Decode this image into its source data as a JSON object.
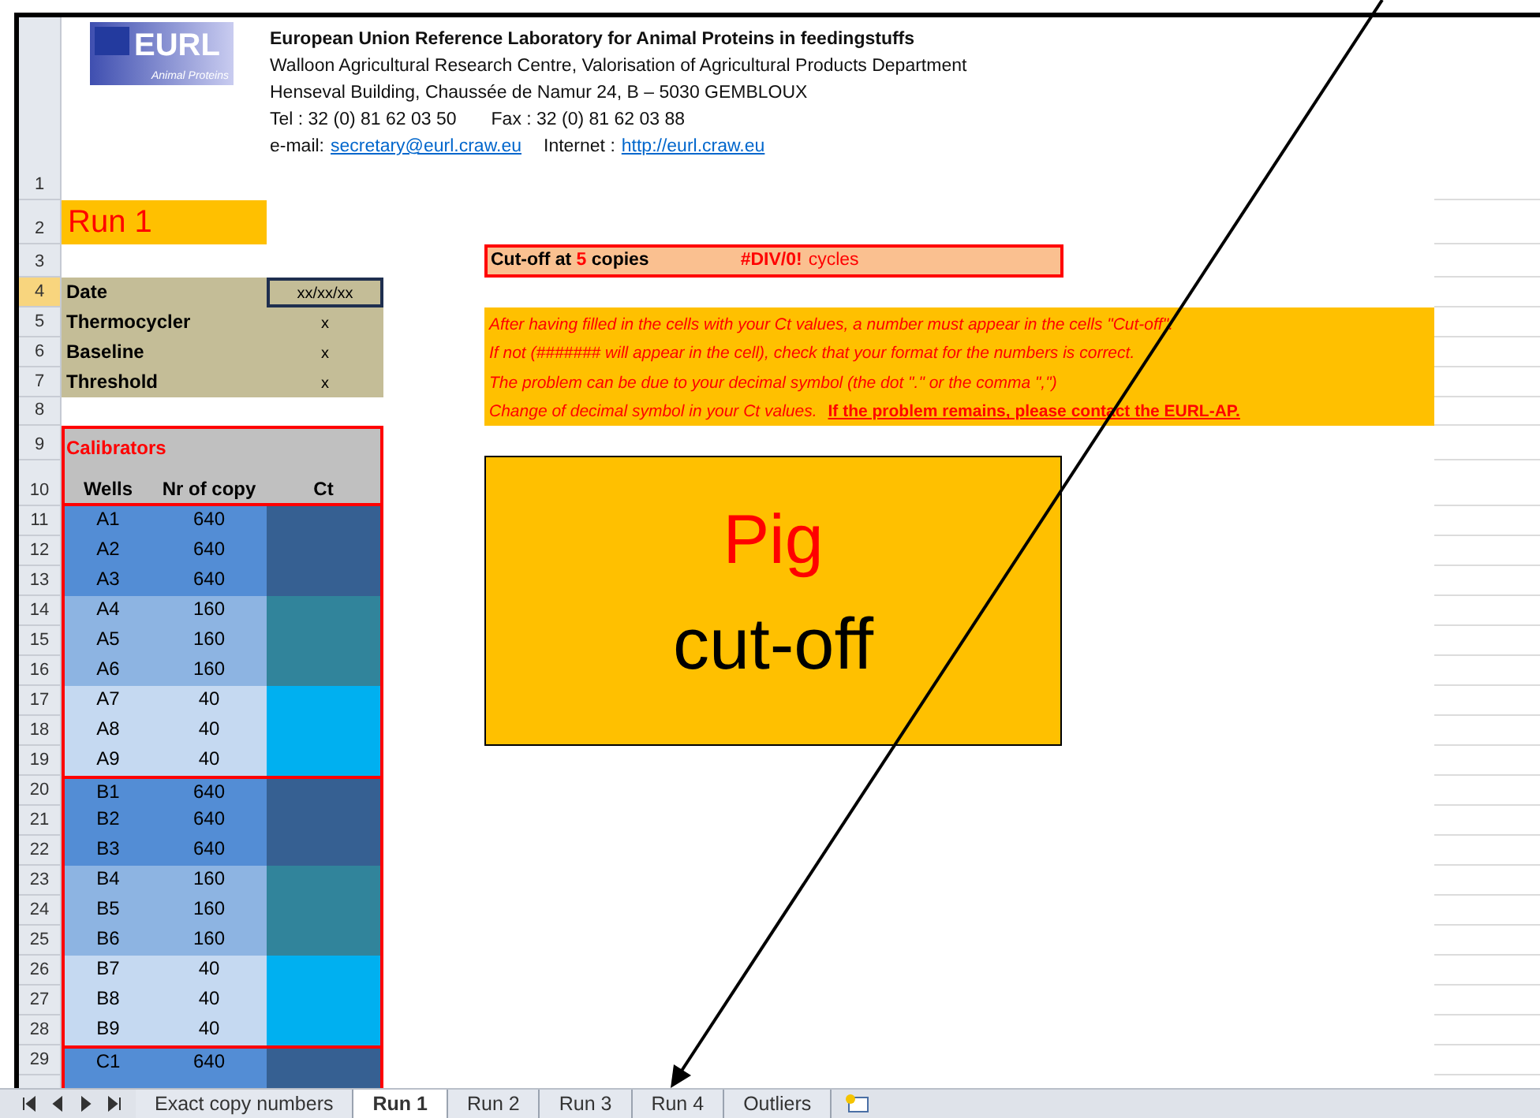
{
  "header": {
    "logo": {
      "text": "EURL",
      "subtitle": "Animal Proteins"
    },
    "title": "European Union Reference Laboratory for Animal Proteins in feedingstuffs",
    "lines": [
      "Walloon Agricultural Research Centre, Valorisation of Agricultural Products Department",
      "Henseval Building, Chaussée de Namur 24,  B – 5030  GEMBLOUX"
    ],
    "phone": "Tel : 32 (0) 81 62 03 50",
    "fax": "Fax : 32 (0) 81 62 03 88",
    "email_label": "e-mail:",
    "email": "secretary@eurl.craw.eu",
    "internet_label": "Internet :",
    "internet": "http://eurl.craw.eu"
  },
  "row_headers": [
    {
      "label": "1",
      "selected": false
    },
    {
      "label": "2",
      "selected": false
    },
    {
      "label": "3",
      "selected": false
    },
    {
      "label": "4",
      "selected": true
    },
    {
      "label": "5",
      "selected": false
    },
    {
      "label": "6",
      "selected": false
    },
    {
      "label": "7",
      "selected": false
    },
    {
      "label": "8",
      "selected": false
    },
    {
      "label": "9",
      "selected": false
    },
    {
      "label": "10",
      "selected": false
    },
    {
      "label": "11",
      "selected": false
    },
    {
      "label": "12",
      "selected": false
    },
    {
      "label": "13",
      "selected": false
    },
    {
      "label": "14",
      "selected": false
    },
    {
      "label": "15",
      "selected": false
    },
    {
      "label": "16",
      "selected": false
    },
    {
      "label": "17",
      "selected": false
    },
    {
      "label": "18",
      "selected": false
    },
    {
      "label": "19",
      "selected": false
    },
    {
      "label": "20",
      "selected": false
    },
    {
      "label": "21",
      "selected": false
    },
    {
      "label": "22",
      "selected": false
    },
    {
      "label": "23",
      "selected": false
    },
    {
      "label": "24",
      "selected": false
    },
    {
      "label": "25",
      "selected": false
    },
    {
      "label": "26",
      "selected": false
    },
    {
      "label": "27",
      "selected": false
    },
    {
      "label": "28",
      "selected": false
    },
    {
      "label": "29",
      "selected": false
    }
  ],
  "run_title": "Run 1",
  "run_info": [
    {
      "label": "Date",
      "value": "xx/xx/xx",
      "selected": true
    },
    {
      "label": "Thermocycler",
      "value": "x",
      "selected": false
    },
    {
      "label": "Baseline",
      "value": "x",
      "selected": false
    },
    {
      "label": "Threshold",
      "value": "x",
      "selected": false
    }
  ],
  "calibrators": {
    "title": "Calibrators",
    "columns": [
      "Wells",
      "Nr of copy",
      "Ct"
    ],
    "groups": [
      {
        "rows": [
          {
            "well": "A1",
            "copies": "640",
            "color": "#366092"
          },
          {
            "well": "A2",
            "copies": "640",
            "color": "#366092"
          },
          {
            "well": "A3",
            "copies": "640",
            "color": "#366092"
          },
          {
            "well": "A4",
            "copies": "160",
            "color": "#31849b"
          },
          {
            "well": "A5",
            "copies": "160",
            "color": "#31849b"
          },
          {
            "well": "A6",
            "copies": "160",
            "color": "#31849b"
          },
          {
            "well": "A7",
            "copies": "40",
            "color": "#00b0f0"
          },
          {
            "well": "A8",
            "copies": "40",
            "color": "#00b0f0"
          },
          {
            "well": "A9",
            "copies": "40",
            "color": "#00b0f0"
          }
        ]
      },
      {
        "rows": [
          {
            "well": "B1",
            "copies": "640",
            "color": "#366092"
          },
          {
            "well": "B2",
            "copies": "640",
            "color": "#366092"
          },
          {
            "well": "B3",
            "copies": "640",
            "color": "#366092"
          },
          {
            "well": "B4",
            "copies": "160",
            "color": "#31849b"
          },
          {
            "well": "B5",
            "copies": "160",
            "color": "#31849b"
          },
          {
            "well": "B6",
            "copies": "160",
            "color": "#31849b"
          },
          {
            "well": "B7",
            "copies": "40",
            "color": "#00b0f0"
          },
          {
            "well": "B8",
            "copies": "40",
            "color": "#00b0f0"
          },
          {
            "well": "B9",
            "copies": "40",
            "color": "#00b0f0"
          }
        ]
      },
      {
        "rows": [
          {
            "well": "C1",
            "copies": "640",
            "color": "#366092"
          },
          {
            "color": "#366092"
          }
        ]
      }
    ]
  },
  "cutoff": {
    "prefix": "Cut-off at",
    "copies": "5",
    "suffix": "copies",
    "result": "#DIV/0!",
    "unit": "cycles"
  },
  "instructions": {
    "lines": [
      "After having filled in the cells with your Ct values, a number must appear in the cells \"Cut-off\".",
      "If not (####### will appear in the cell), check that your format for the numbers is correct.",
      "The problem can be due to your decimal symbol (the dot \".\" or the comma \",\")"
    ],
    "last_line": "Change of decimal symbol in your Ct values.",
    "warning": "If the problem remains, please contact the EURL-AP."
  },
  "species_box": {
    "species": "Pig",
    "label": "cut-off"
  },
  "sheet_tabs": [
    {
      "label": "Exact copy numbers",
      "selected": false
    },
    {
      "label": "Run 1",
      "selected": true
    },
    {
      "label": "Run 2",
      "selected": false
    },
    {
      "label": "Run 3",
      "selected": false
    },
    {
      "label": "Run 4",
      "selected": false
    },
    {
      "label": "Outliers",
      "selected": false
    }
  ]
}
